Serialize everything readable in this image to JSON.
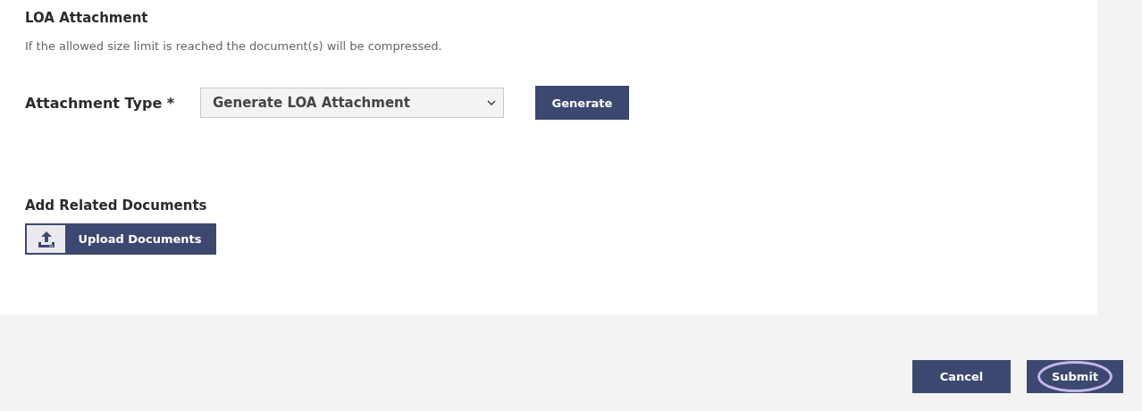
{
  "section": {
    "title": "LOA Attachment",
    "note": "If the allowed size limit is reached the document(s) will be compressed."
  },
  "attachment_type": {
    "label": "Attachment Type *",
    "value": "Generate LOA Attachment",
    "button": "Generate"
  },
  "related": {
    "title": "Add Related Documents",
    "button": "Upload Documents"
  },
  "actions": [
    {
      "label": "Cancel",
      "focused": false
    },
    {
      "label": "Submit",
      "focused": true
    }
  ]
}
